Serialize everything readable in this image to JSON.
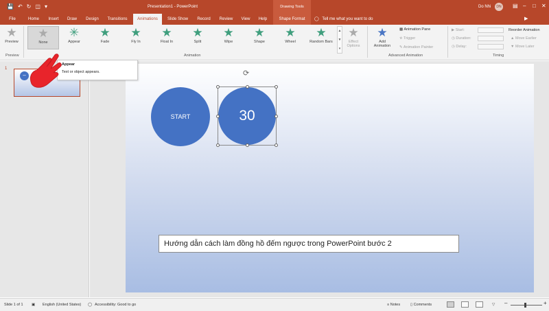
{
  "window": {
    "title": "Presentation1 - PowerPoint",
    "contextual_label": "Drawing Tools",
    "user_name": "Do Nhi",
    "user_initials": "DN",
    "qat_icons": [
      "save-icon",
      "undo-icon",
      "redo-icon",
      "start-from-beginning-icon",
      "customize-icon"
    ]
  },
  "tabs": [
    {
      "label": "File"
    },
    {
      "label": "Home"
    },
    {
      "label": "Insert"
    },
    {
      "label": "Draw"
    },
    {
      "label": "Design"
    },
    {
      "label": "Transitions"
    },
    {
      "label": "Animations",
      "active": true
    },
    {
      "label": "Slide Show"
    },
    {
      "label": "Record"
    },
    {
      "label": "Review"
    },
    {
      "label": "View"
    },
    {
      "label": "Help"
    },
    {
      "label": "Shape Format",
      "contextual": true
    }
  ],
  "tell_me": "Tell me what you want to do",
  "ribbon": {
    "preview": {
      "label": "Preview",
      "group": "Preview"
    },
    "animations": [
      {
        "label": "None",
        "selected": true,
        "color": "grey"
      },
      {
        "label": "Appear",
        "color": "green"
      },
      {
        "label": "Fade",
        "color": "green"
      },
      {
        "label": "Fly In",
        "color": "green"
      },
      {
        "label": "Float In",
        "color": "green"
      },
      {
        "label": "Split",
        "color": "green"
      },
      {
        "label": "Wipe",
        "color": "green"
      },
      {
        "label": "Shape",
        "color": "green"
      },
      {
        "label": "Wheel",
        "color": "green"
      },
      {
        "label": "Random Bars",
        "color": "green"
      }
    ],
    "effect_options_line1": "Effect",
    "effect_options_line2": "Options",
    "animation_group": "Animation",
    "add_animation_line1": "Add",
    "add_animation_line2": "Animation",
    "animation_pane": "Animation Pane",
    "trigger": "Trigger",
    "animation_painter": "Animation Painter",
    "advanced_group": "Advanced Animation",
    "start": "Start:",
    "duration": "Duration:",
    "delay": "Delay:",
    "reorder": "Reorder Animation",
    "move_earlier": "Move Earlier",
    "move_later": "Move Later",
    "timing_group": "Timing",
    "accent_color": "#b7472a"
  },
  "tooltip": {
    "title": "Appear",
    "description": "Text or object appears."
  },
  "thumbnail": {
    "slide_number": "1"
  },
  "slide": {
    "start_label": "START",
    "countdown_value": "30",
    "caption": "Hướng dẫn cách làm đồng hồ đếm ngược trong PowerPoint bước 2",
    "shape_color": "#4472c4"
  },
  "status": {
    "slide_info": "Slide 1 of 1",
    "language": "English (United States)",
    "accessibility": "Accessibility: Good to go",
    "notes": "Notes",
    "comments": "Comments"
  }
}
